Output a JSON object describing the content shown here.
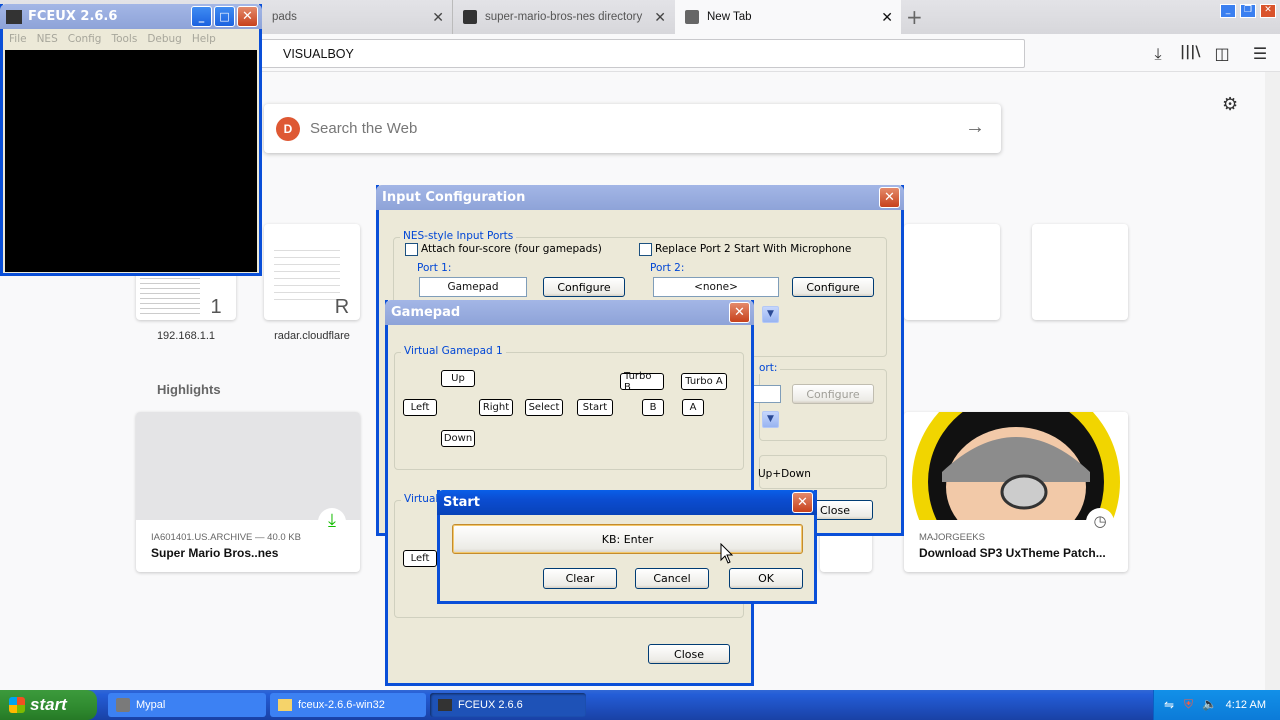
{
  "firefox": {
    "tabs": [
      {
        "label": "pads"
      },
      {
        "label": "super-mario-bros-nes directory lis"
      },
      {
        "label": "New Tab"
      }
    ],
    "new_tab_symbol": "+",
    "url": "VISUALBOY",
    "search_placeholder": "Search the Web",
    "top_sites": [
      {
        "letter": "1",
        "caption": "192.168.1.1"
      },
      {
        "letter": "R",
        "caption": "radar.cloudflare"
      }
    ],
    "highlights_label": "Highlights",
    "highlight_cards": [
      {
        "source": "IA601401.US.ARCHIVE — 40.0 KB",
        "title": "Super Mario Bros..nes"
      },
      {
        "source": "MAJORGEEKS",
        "title": "Download SP3 UxTheme Patch..."
      }
    ]
  },
  "fceux": {
    "title": "FCEUX 2.6.6",
    "menu": [
      "File",
      "NES",
      "Config",
      "Tools",
      "Debug",
      "Help"
    ]
  },
  "input_config": {
    "title": "Input Configuration",
    "group_label": "NES-style Input Ports",
    "attach_four_score": "Attach four-score (four gamepads)",
    "replace_port2": "Replace Port 2 Start With Microphone",
    "port1_label": "Port 1:",
    "port1_value": "Gamepad",
    "port2_label": "Port 2:",
    "port2_value": "<none>",
    "configure": "Configure",
    "port_label_partial": "ort:",
    "updown_partial": "Up+Down",
    "close_partial": "Close"
  },
  "gamepad": {
    "title": "Gamepad",
    "group1": "Virtual Gamepad 1",
    "group2_partial": "Virtual G",
    "buttons": {
      "up": "Up",
      "left": "Left",
      "right": "Right",
      "down": "Down",
      "select": "Select",
      "start": "Start",
      "turbo_b": "Turbo B",
      "turbo_a": "Turbo A",
      "b": "B",
      "a": "A"
    },
    "left2": "Left",
    "close": "Close"
  },
  "start_dialog": {
    "title": "Start",
    "binding": "KB: Enter",
    "clear": "Clear",
    "cancel": "Cancel",
    "ok": "OK"
  },
  "taskbar": {
    "start": "start",
    "items": [
      {
        "label": "Mypal"
      },
      {
        "label": "fceux-2.6.6-win32"
      },
      {
        "label": "FCEUX 2.6.6"
      }
    ],
    "clock": "4:12 AM"
  }
}
